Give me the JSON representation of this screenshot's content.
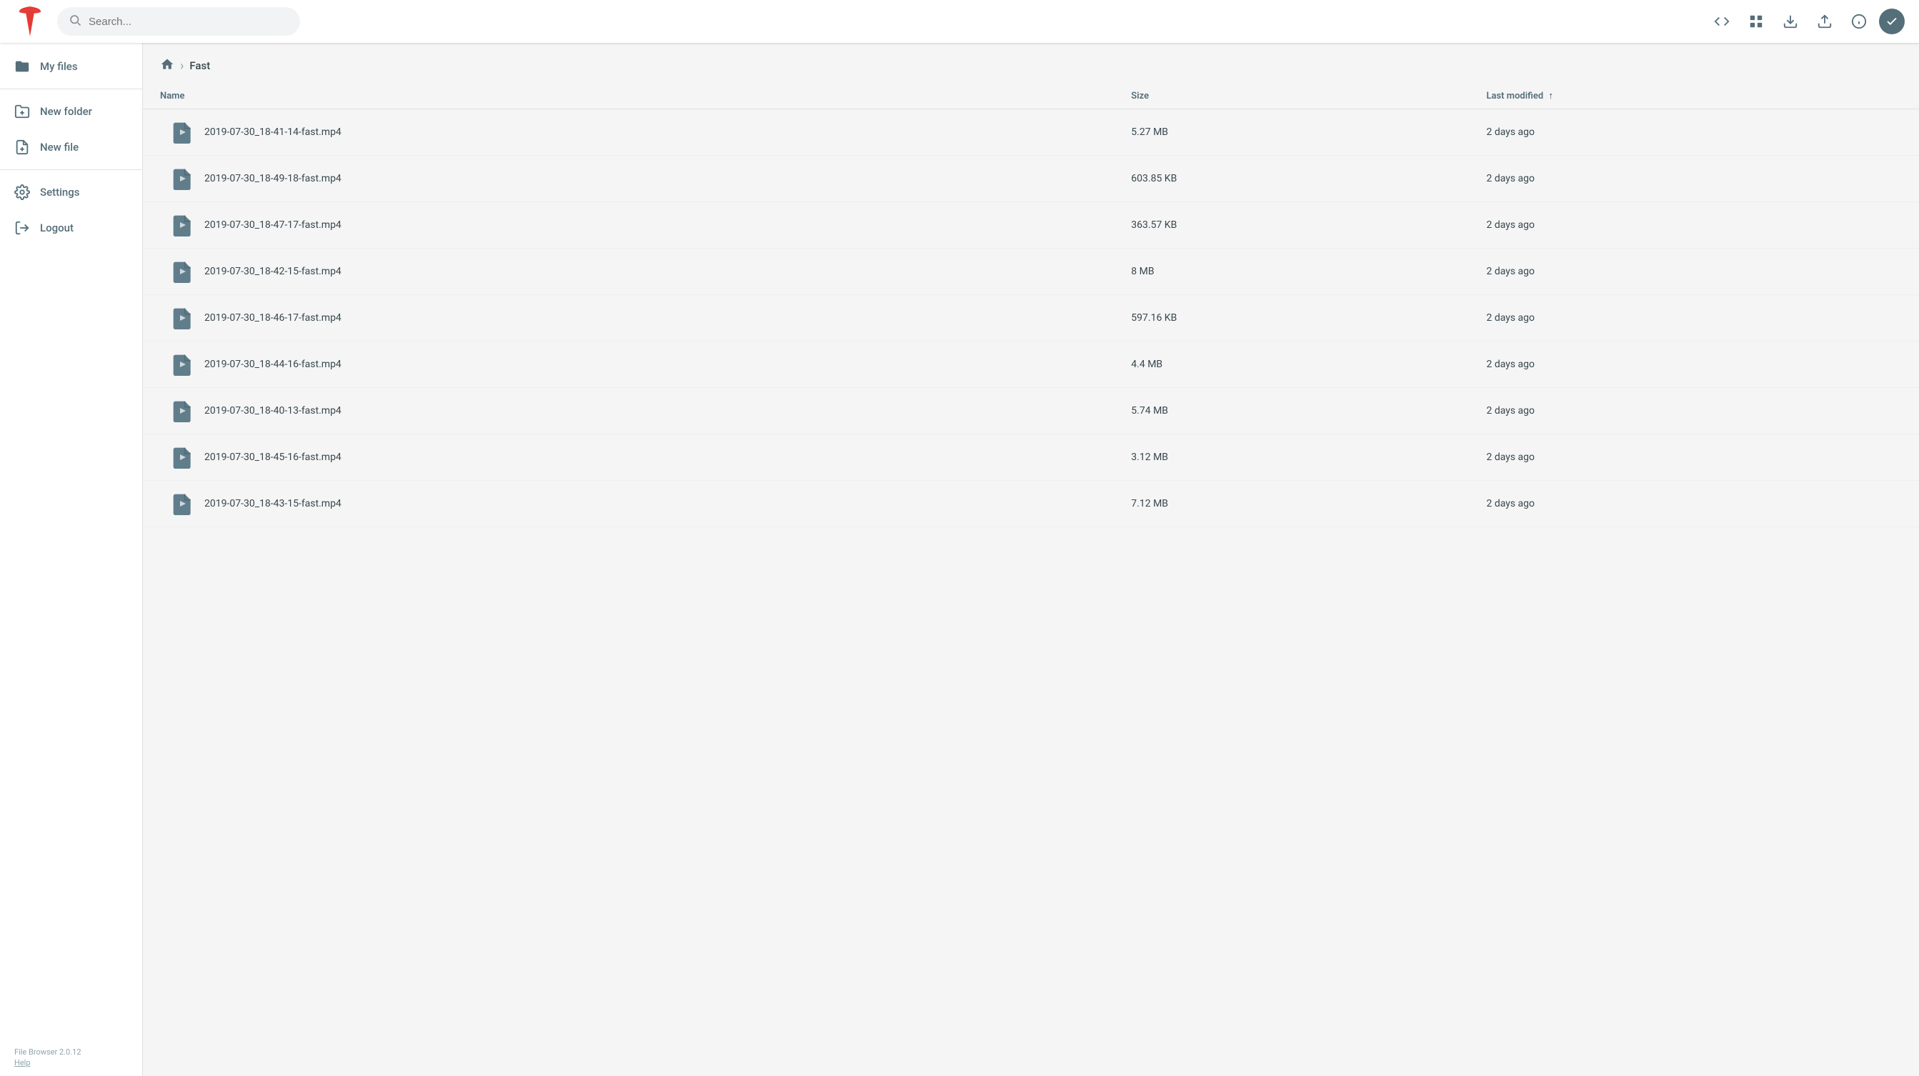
{
  "app": {
    "title": "File Browser",
    "version": "File Browser 2.0.12",
    "help": "Help"
  },
  "header": {
    "search_placeholder": "Search...",
    "buttons": {
      "code": "</>",
      "grid": "grid",
      "download": "download",
      "upload": "upload",
      "info": "info",
      "check": "check"
    }
  },
  "sidebar": {
    "items": [
      {
        "id": "my-files",
        "label": "My files",
        "icon": "folder"
      },
      {
        "id": "new-folder",
        "label": "New folder",
        "icon": "folder-plus"
      },
      {
        "id": "new-file",
        "label": "New file",
        "icon": "file-plus"
      },
      {
        "id": "settings",
        "label": "Settings",
        "icon": "settings"
      },
      {
        "id": "logout",
        "label": "Logout",
        "icon": "logout"
      }
    ],
    "footer": {
      "version": "File Browser 2.0.12",
      "help": "Help"
    }
  },
  "breadcrumb": {
    "home_icon": "home",
    "separator": "›",
    "current": "Fast"
  },
  "file_list": {
    "columns": {
      "name": "Name",
      "size": "Size",
      "modified": "Last modified"
    },
    "files": [
      {
        "name": "2019-07-30_18-41-14-fast.mp4",
        "size": "5.27 MB",
        "modified": "2 days ago"
      },
      {
        "name": "2019-07-30_18-49-18-fast.mp4",
        "size": "603.85 KB",
        "modified": "2 days ago"
      },
      {
        "name": "2019-07-30_18-47-17-fast.mp4",
        "size": "363.57 KB",
        "modified": "2 days ago"
      },
      {
        "name": "2019-07-30_18-42-15-fast.mp4",
        "size": "8 MB",
        "modified": "2 days ago"
      },
      {
        "name": "2019-07-30_18-46-17-fast.mp4",
        "size": "597.16 KB",
        "modified": "2 days ago"
      },
      {
        "name": "2019-07-30_18-44-16-fast.mp4",
        "size": "4.4 MB",
        "modified": "2 days ago"
      },
      {
        "name": "2019-07-30_18-40-13-fast.mp4",
        "size": "5.74 MB",
        "modified": "2 days ago"
      },
      {
        "name": "2019-07-30_18-45-16-fast.mp4",
        "size": "3.12 MB",
        "modified": "2 days ago"
      },
      {
        "name": "2019-07-30_18-43-15-fast.mp4",
        "size": "7.12 MB",
        "modified": "2 days ago"
      }
    ]
  }
}
